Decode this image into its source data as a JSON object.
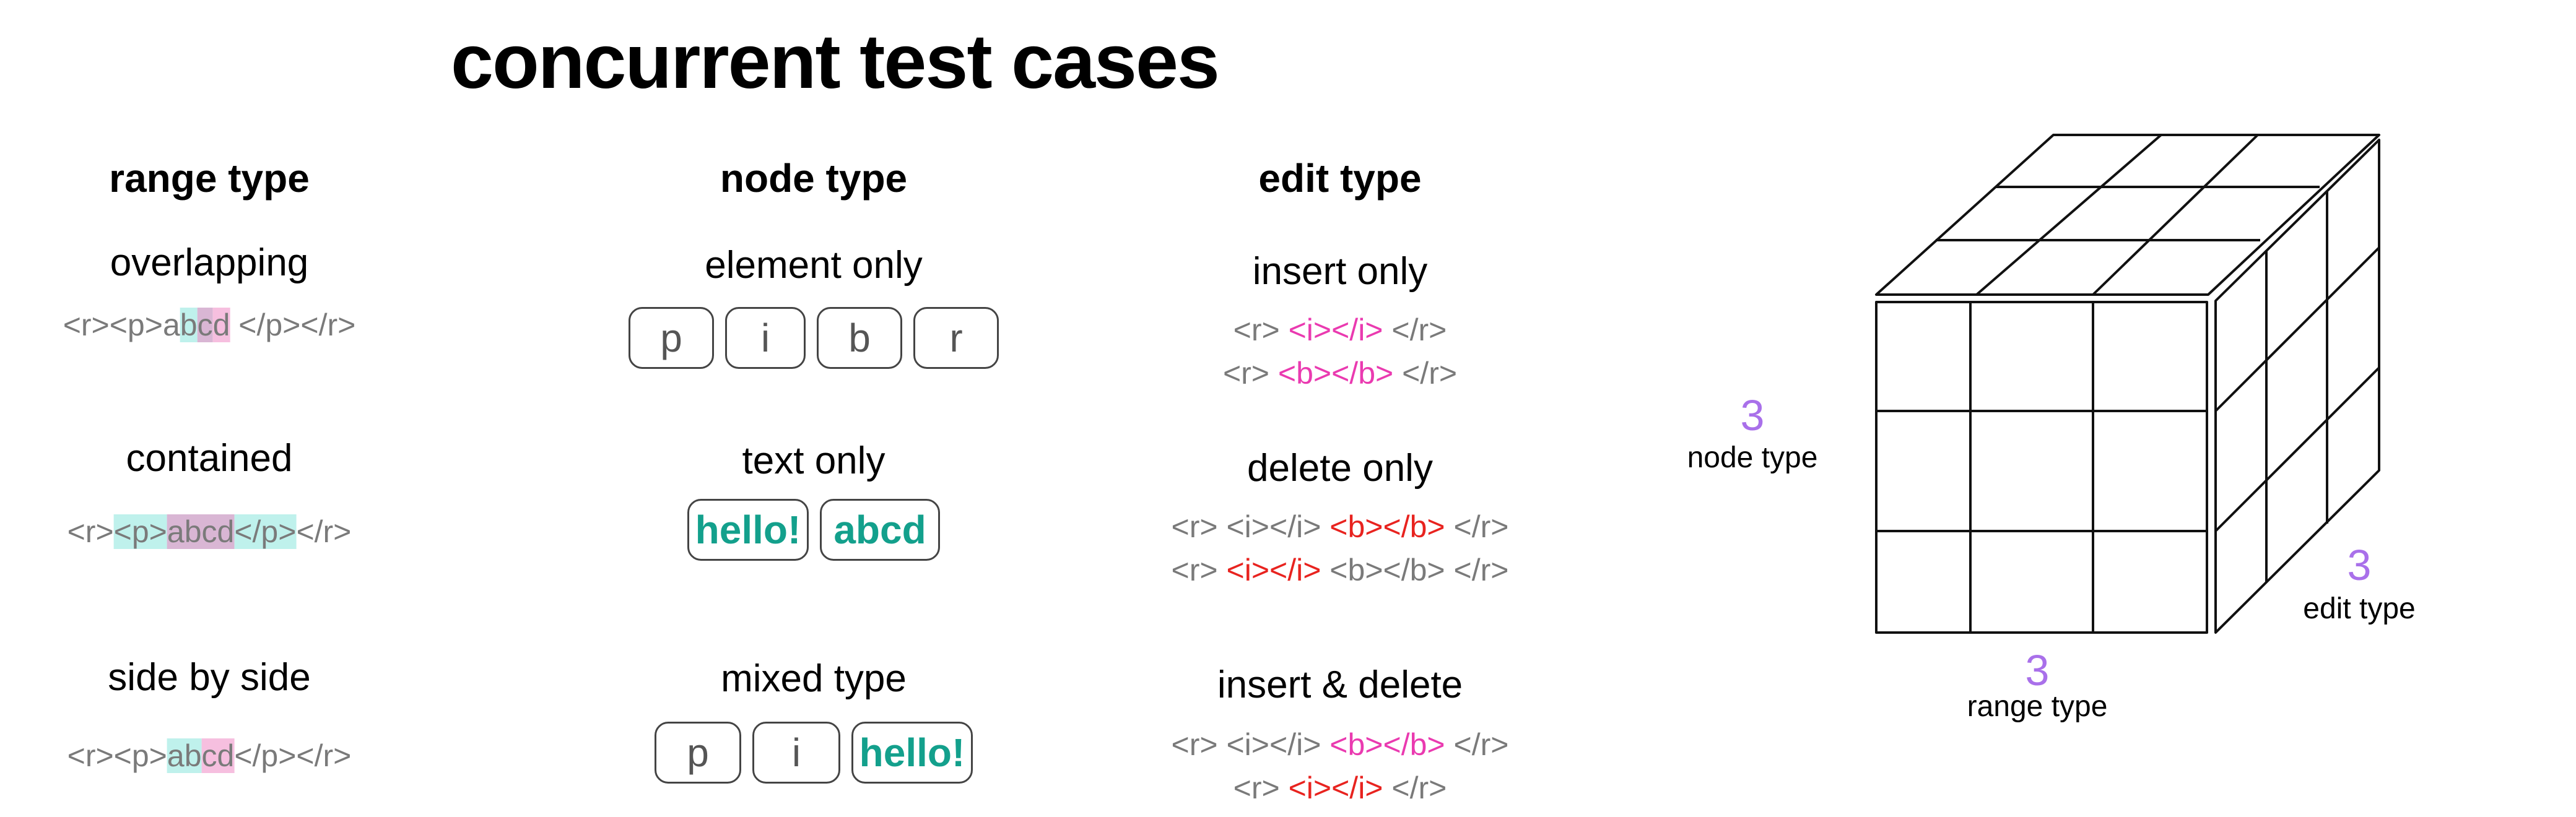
{
  "title": "concurrent test cases",
  "columns": {
    "range": {
      "heading": "range type",
      "cases": [
        {
          "label": "overlapping",
          "before": "<r><p>a",
          "teal": "b",
          "both": "c",
          "pink": "d",
          "after": " </p></r>"
        },
        {
          "label": "contained",
          "before": "<r>",
          "teal_pre": "<p>",
          "both": "abcd",
          "teal_post": "</p>",
          "after": "</r>"
        },
        {
          "label": "side by side",
          "before": "<r><p>",
          "teal": "ab",
          "pink": "cd",
          "after": "</p></r>"
        }
      ]
    },
    "node": {
      "heading": "node type",
      "cases": [
        {
          "label": "element only",
          "pills": [
            "p",
            "i",
            "b",
            "r"
          ]
        },
        {
          "label": "text only",
          "pills": [
            "hello!",
            "abcd"
          ]
        },
        {
          "label": "mixed type",
          "pills": [
            "p",
            "i",
            "hello!"
          ]
        }
      ]
    },
    "edit": {
      "heading": "edit type",
      "cases": [
        {
          "label": "insert only",
          "line1": {
            "pre": "<r> ",
            "mark": "<i></i>",
            "post": " </r>"
          },
          "line2": {
            "pre": "<r> ",
            "mark": "<b></b>",
            "post": " </r>"
          }
        },
        {
          "label": "delete only",
          "line1": {
            "pre": "<r> <i></i> ",
            "mark": "<b></b>",
            "post": " </r>"
          },
          "line2": {
            "pre": "<r> ",
            "mark": "<i></i>",
            "post": " <b></b> </r>"
          }
        },
        {
          "label": "insert & delete",
          "line1": {
            "pre": "<r> <i></i> ",
            "mark": "<b></b>",
            "post": " </r>"
          },
          "line2": {
            "pre": "<r> ",
            "mark": "<i></i>",
            "post": " </r>"
          }
        }
      ]
    }
  },
  "cube": {
    "node": {
      "count": "3",
      "label": "node type"
    },
    "edit": {
      "count": "3",
      "label": "edit type"
    },
    "range": {
      "count": "3",
      "label": "range type"
    }
  },
  "colors": {
    "teal_text": "#13a08c",
    "insert": "#ea3ab0",
    "delete": "#e8231f",
    "count": "#a970ea"
  }
}
